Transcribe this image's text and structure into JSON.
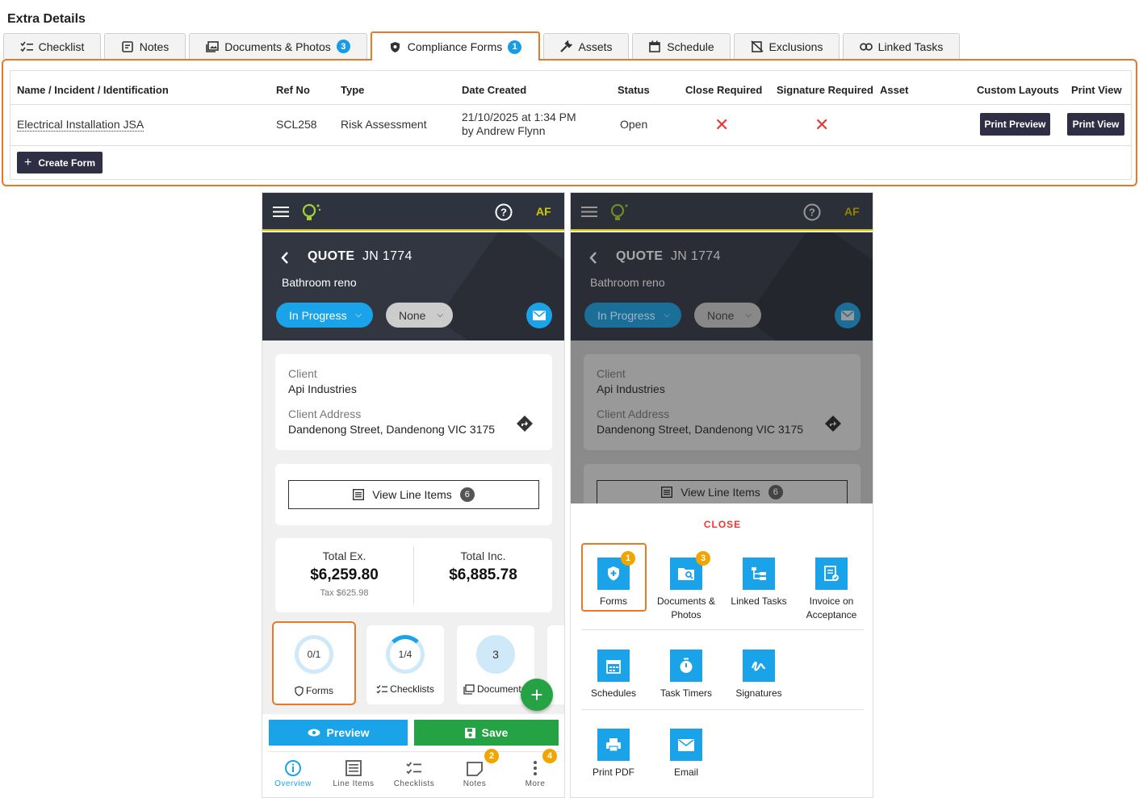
{
  "title": "Extra Details",
  "tabs": [
    {
      "label": "Checklist"
    },
    {
      "label": "Notes"
    },
    {
      "label": "Documents & Photos",
      "badge": "3"
    },
    {
      "label": "Compliance Forms",
      "badge": "1",
      "active": true
    },
    {
      "label": "Assets"
    },
    {
      "label": "Schedule"
    },
    {
      "label": "Exclusions"
    },
    {
      "label": "Linked Tasks"
    }
  ],
  "forms_table": {
    "headers": [
      "Name / Incident / Identification",
      "Ref No",
      "Type",
      "Date Created",
      "Status",
      "Close Required",
      "Signature Required",
      "Asset",
      "Custom Layouts",
      "Print View"
    ],
    "row": {
      "name": "Electrical Installation JSA",
      "ref": "SCL258",
      "type": "Risk Assessment",
      "date_line1": "21/10/2025 at 1:34 PM",
      "date_line2": "by Andrew Flynn",
      "status": "Open",
      "close_required": "✕",
      "signature_required": "✕",
      "print_preview": "Print Preview",
      "print_view": "Print View"
    },
    "create_form": "Create Form"
  },
  "mobile": {
    "user_initials": "AF",
    "header_title": "QUOTE",
    "job_number": "JN 1774",
    "subtitle": "Bathroom reno",
    "status": "In Progress",
    "priority": "None",
    "client_label": "Client",
    "client": "Api Industries",
    "address_label": "Client Address",
    "address": "Dandenong Street, Dandenong VIC 3175",
    "view_line_items": "View Line Items",
    "line_items_count": "6",
    "total_ex_label": "Total Ex.",
    "total_ex": "$6,259.80",
    "tax": "Tax $625.98",
    "total_inc_label": "Total Inc.",
    "total_inc": "$6,885.78",
    "tiles": [
      {
        "value": "0/1",
        "label": "Forms",
        "progress": 0.0
      },
      {
        "value": "1/4",
        "label": "Checklists",
        "progress": 0.25
      },
      {
        "value": "3",
        "label": "Documents"
      }
    ],
    "preview": "Preview",
    "save": "Save",
    "nav": [
      {
        "label": "Overview",
        "active": true
      },
      {
        "label": "Line Items"
      },
      {
        "label": "Checklists"
      },
      {
        "label": "Notes",
        "badge": "2"
      },
      {
        "label": "More",
        "badge": "4"
      }
    ],
    "menu": {
      "close": "CLOSE",
      "items": [
        {
          "label": "Forms",
          "badge": "1"
        },
        {
          "label": "Documents & Photos",
          "badge": "3"
        },
        {
          "label": "Linked Tasks"
        },
        {
          "label": "Invoice on Acceptance"
        },
        {
          "label": "Schedules"
        },
        {
          "label": "Task Timers"
        },
        {
          "label": "Signatures"
        },
        {
          "label": "Print PDF"
        },
        {
          "label": "Email"
        }
      ]
    }
  },
  "colors": {
    "accent_orange": "#e8782a",
    "blue": "#1aa3e8",
    "green": "#25a244",
    "dark": "#2e2f45"
  }
}
